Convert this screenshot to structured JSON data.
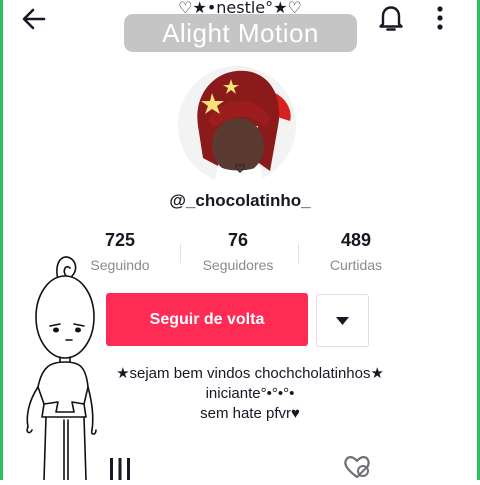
{
  "header": {
    "title": "♡★•nestle°★♡",
    "back_icon": "arrow-left-icon",
    "bell_icon": "bell-icon",
    "more_icon": "more-vertical-icon"
  },
  "watermark": {
    "text": "Alight Motion"
  },
  "profile": {
    "handle": "@_chocolatinho_",
    "avatar": "avatar-image"
  },
  "stats": [
    {
      "value": "725",
      "label": "Seguindo"
    },
    {
      "value": "76",
      "label": "Seguidores"
    },
    {
      "value": "489",
      "label": "Curtidas"
    }
  ],
  "actions": {
    "follow_label": "Seguir de volta",
    "dropdown_icon": "caret-down-icon"
  },
  "bio": {
    "lines": [
      "★sejam bem vindos chochcholatinhos★",
      "iniciante°•°•°•",
      "sem hate pfvr♥"
    ]
  },
  "tabs": {
    "videos_icon": "grid-bars-icon",
    "liked_icon": "heart-hidden-icon"
  },
  "colors": {
    "accent": "#fe2c55",
    "text": "#161823",
    "muted": "#8a8b91",
    "edge": "#2fbf63"
  }
}
